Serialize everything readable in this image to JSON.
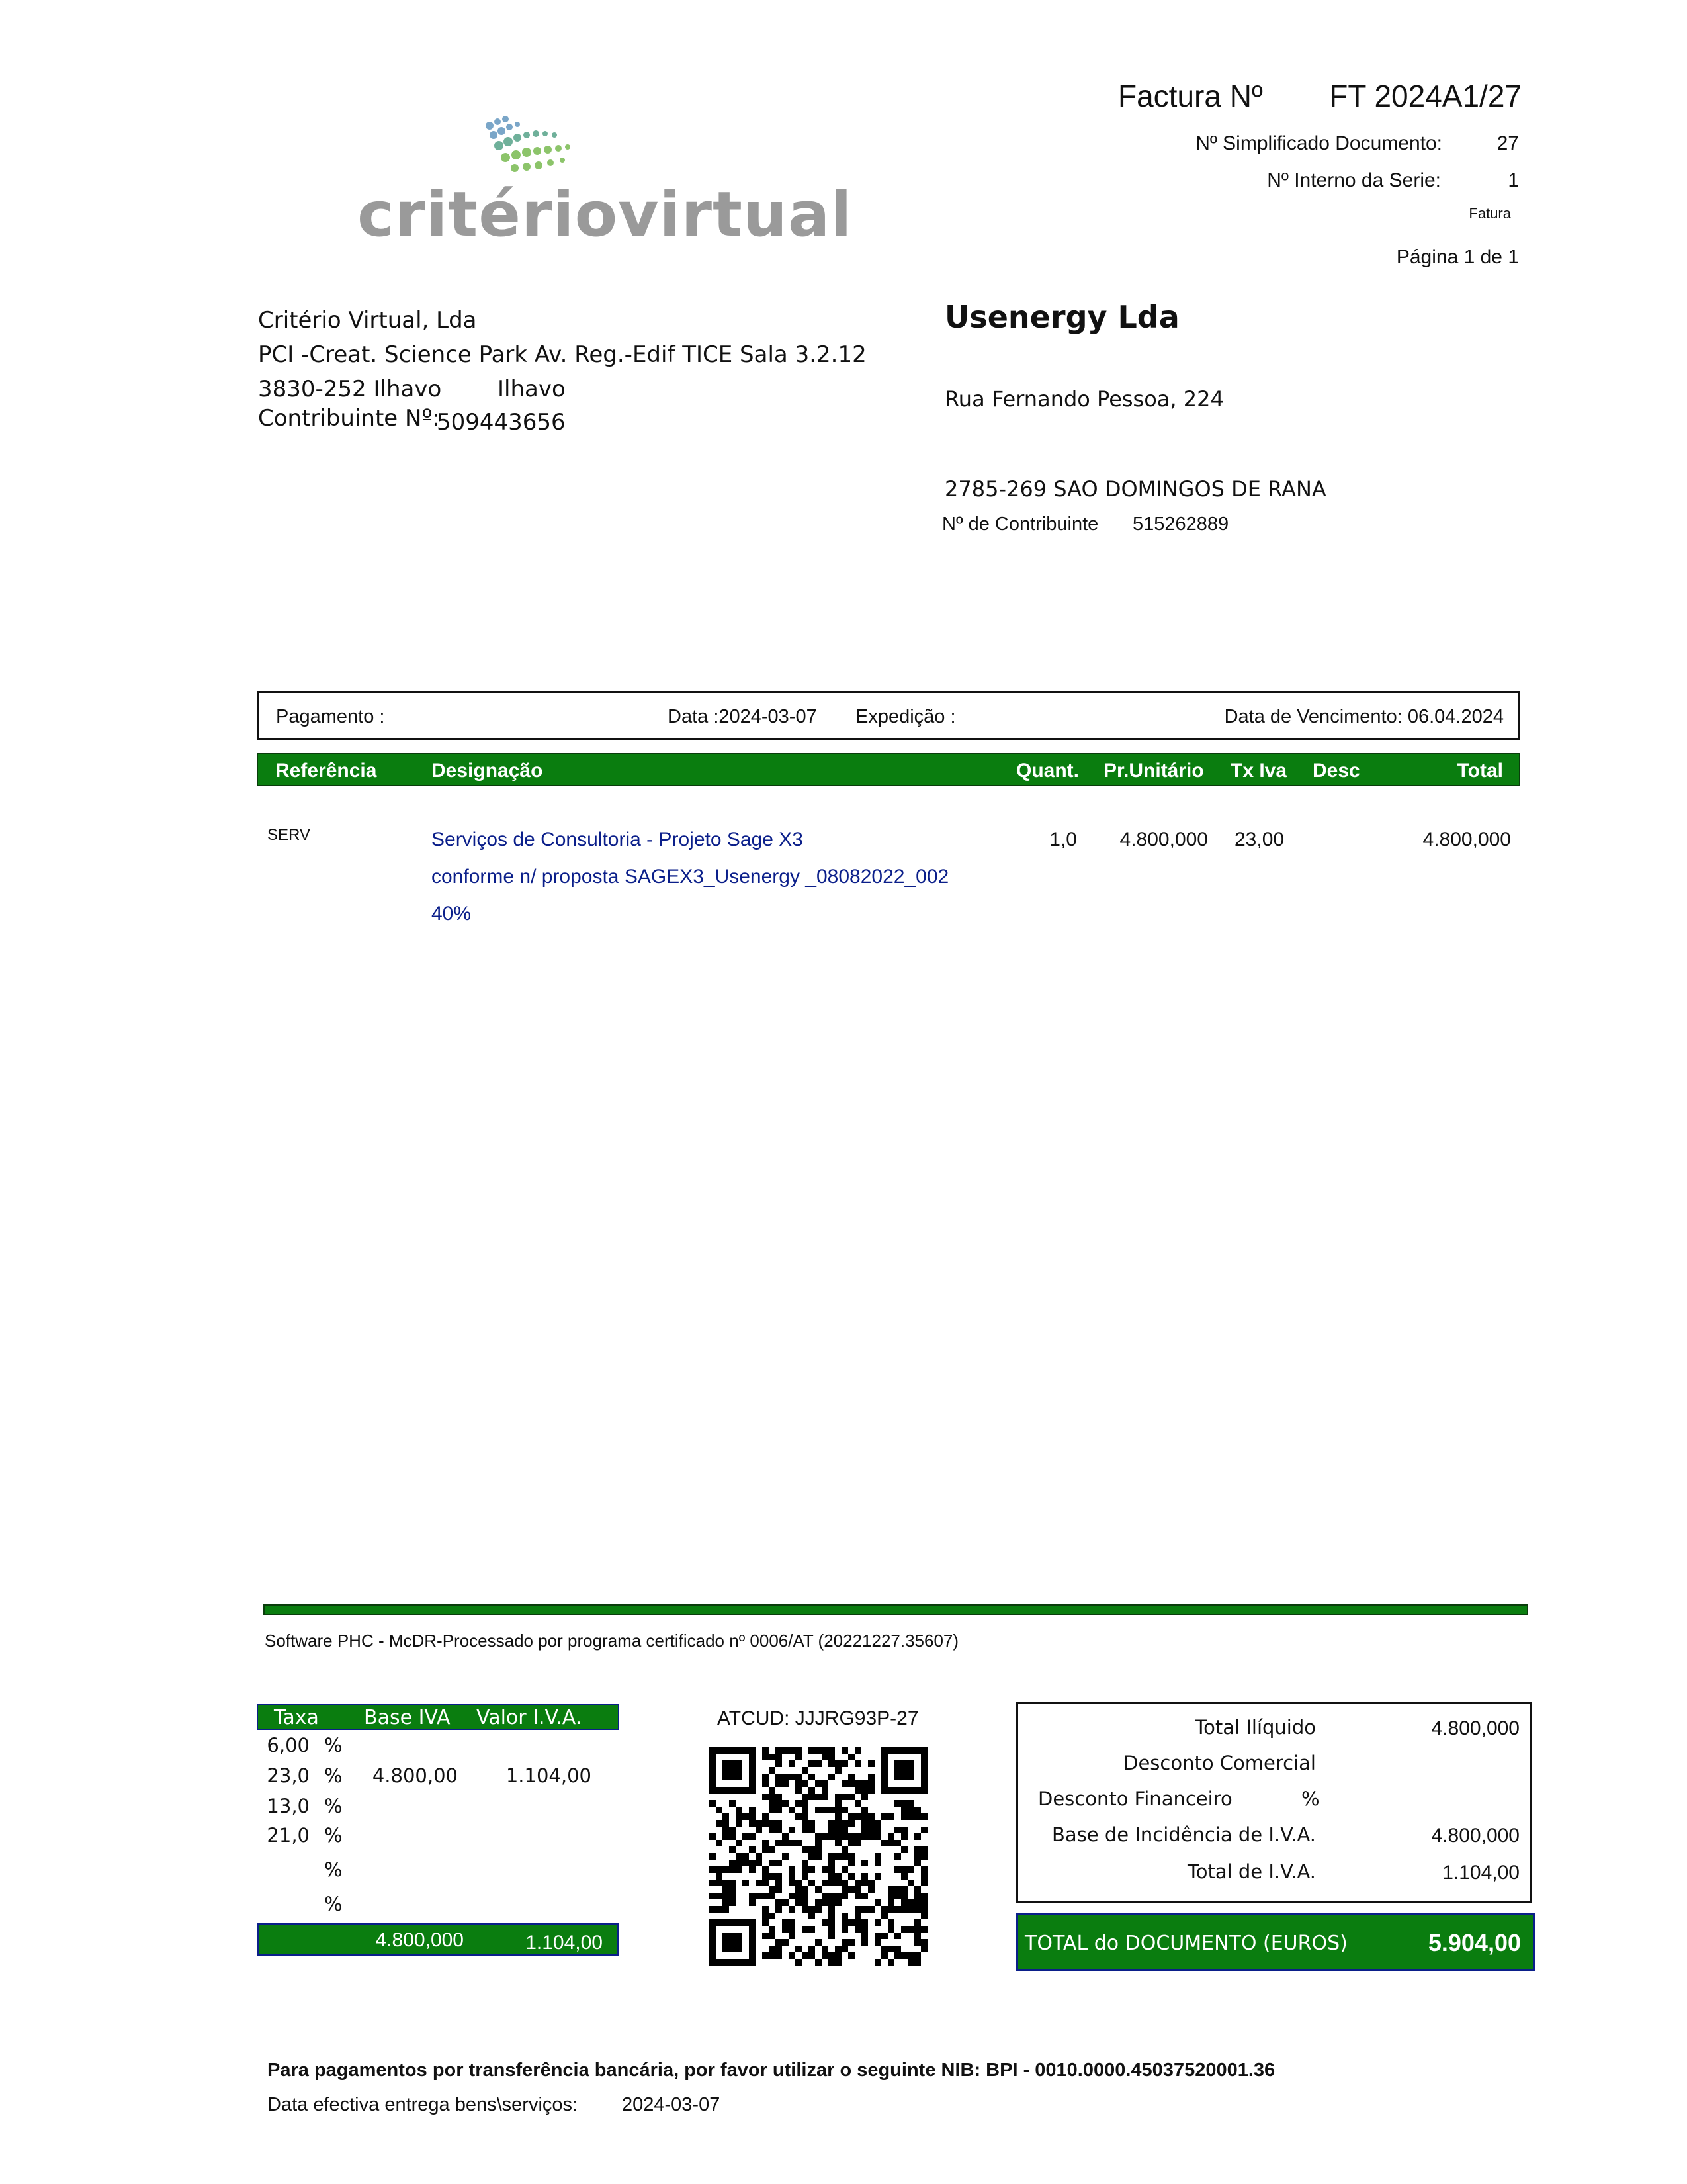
{
  "header": {
    "doc_label": "Factura Nº",
    "doc_number": "FT 2024A1/27",
    "simplified_label": "Nº Simplificado Documento:",
    "simplified_value": "27",
    "internal_label": "Nº Interno da Serie:",
    "internal_value": "1",
    "doc_type": "Fatura",
    "page": "Página 1 de 1"
  },
  "logo": {
    "text": "critériovirtual"
  },
  "seller": {
    "name": "Critério Virtual, Lda",
    "address": "PCI -Creat. Science Park Av. Reg.-Edif TICE Sala 3.2.12",
    "postal": "3830-252 Ilhavo",
    "city": "Ilhavo",
    "nif_label": "Contribuinte Nº:",
    "nif": "509443656"
  },
  "customer": {
    "name": "Usenergy Lda",
    "address": "Rua Fernando Pessoa, 224",
    "postal_city": "2785-269 SAO DOMINGOS DE RANA",
    "nif_label": "Nº de Contribuinte",
    "nif": "515262889"
  },
  "info_bar": {
    "payment": "Pagamento :",
    "date": "Data :2024-03-07",
    "shipping": "Expedição :",
    "due": "Data de Vencimento: 06.04.2024"
  },
  "table": {
    "headers": [
      "Referência",
      "Designação",
      "Quant.",
      "Pr.Unitário",
      "Tx Iva",
      "Desc",
      "Total"
    ],
    "rows": [
      {
        "ref": "SERV",
        "lines": [
          "Serviços de Consultoria - Projeto Sage X3",
          "conforme n/ proposta SAGEX3_Usenergy _08082022_002",
          "40%"
        ],
        "qty": "1,0",
        "unit_price": "4.800,000",
        "vat": "23,00",
        "disc": "",
        "total": "4.800,000"
      }
    ]
  },
  "footer_note": "Software PHC - McDR-Processado por programa certificado nº 0006/AT (20221227.35607)",
  "vat_summary": {
    "headers": [
      "Taxa",
      "Base IVA",
      "Valor I.V.A."
    ],
    "rows": [
      {
        "rate": "6,00",
        "pct": "%",
        "base": "",
        "value": ""
      },
      {
        "rate": "23,0",
        "pct": "%",
        "base": "4.800,00",
        "value": "1.104,00"
      },
      {
        "rate": "13,0",
        "pct": "%",
        "base": "",
        "value": ""
      },
      {
        "rate": "21,0",
        "pct": "%",
        "base": "",
        "value": ""
      },
      {
        "rate": "",
        "pct": "%",
        "base": "",
        "value": ""
      },
      {
        "rate": "",
        "pct": "%",
        "base": "",
        "value": ""
      }
    ],
    "total_base": "4.800,000",
    "total_value": "1.104,00"
  },
  "atcud": "ATCUD: JJJRG93P-27",
  "totals": {
    "net_label": "Total Ilíquido",
    "net": "4.800,000",
    "commercial_label": "Desconto Comercial",
    "commercial": "",
    "financial_label": "Desconto Financeiro",
    "financial_pct": "%",
    "base_label": "Base de Incidência de I.V.A.",
    "base": "4.800,000",
    "vat_label": "Total de I.V.A.",
    "vat": "1.104,00",
    "doc_total_label": "TOTAL do DOCUMENTO (EUROS)",
    "doc_total": "5.904,00"
  },
  "bank_note": "Para pagamentos por transferência bancária, por favor utilizar o seguinte NIB: BPI - 0010.0000.45037520001.36",
  "delivery": {
    "label": "Data efectiva entrega bens\\serviços:",
    "value": "2024-03-07"
  },
  "colors": {
    "brand_green": "#0a7d0f",
    "blue_text": "#0b1f8a"
  }
}
